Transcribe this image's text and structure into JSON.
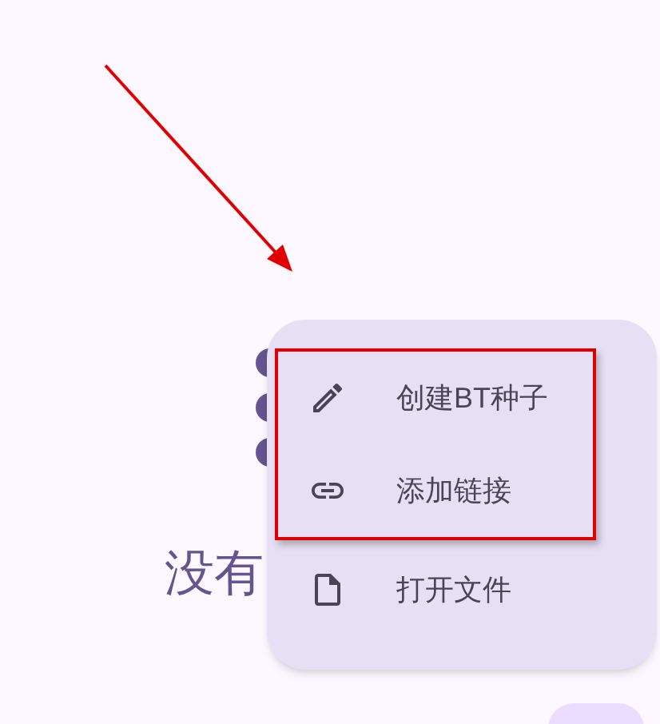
{
  "background": {
    "empty_text": "没有"
  },
  "menu": {
    "items": [
      {
        "label": "创建BT种子",
        "kind": "edit",
        "highlighted": true
      },
      {
        "label": "添加链接",
        "kind": "link",
        "highlighted": true
      },
      {
        "label": "打开文件",
        "kind": "file",
        "highlighted": false
      }
    ]
  }
}
